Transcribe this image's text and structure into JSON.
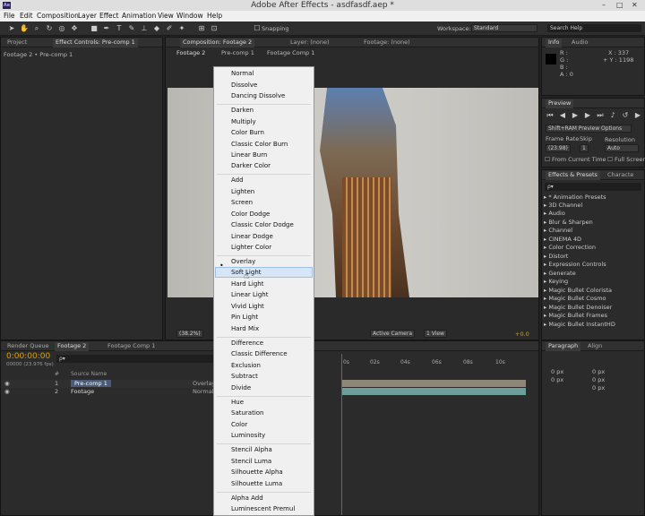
{
  "titlebar": {
    "title": "Adobe After Effects - asdfasdf.aep *",
    "app_badge": "Ae",
    "minimize": "–",
    "maximize": "□",
    "close": "✕"
  },
  "menu": [
    "File",
    "Edit",
    "Composition",
    "Layer",
    "Effect",
    "Animation",
    "View",
    "Window",
    "Help"
  ],
  "toolbar": {
    "snapping": "Snapping",
    "workspace_label": "Workspace:",
    "workspace_value": "Standard",
    "search_help": "Search Help"
  },
  "left_panel": {
    "tab_project": "Project",
    "tab_effect_controls": "Effect Controls: Pre-comp 1",
    "breadcrumb": "Footage 2 • Pre-comp 1"
  },
  "comp_panel": {
    "tab_composition": "Composition: Footage 2",
    "tab_layer": "Layer: (none)",
    "tab_footage": "Footage: (none)",
    "flow_tabs": [
      "Footage 2",
      "Pre-comp 1",
      "Footage Comp 1"
    ],
    "zoom": "(38.2%)",
    "camera": "Active Camera",
    "view": "1 View",
    "exposure": "+0.0"
  },
  "blend_menu": {
    "groups": [
      [
        "Normal",
        "Dissolve",
        "Dancing Dissolve"
      ],
      [
        "Darken",
        "Multiply",
        "Color Burn",
        "Classic Color Burn",
        "Linear Burn",
        "Darker Color"
      ],
      [
        "Add",
        "Lighten",
        "Screen",
        "Color Dodge",
        "Classic Color Dodge",
        "Linear Dodge",
        "Lighter Color"
      ],
      [
        "Overlay",
        "Soft Light",
        "Hard Light",
        "Linear Light",
        "Vivid Light",
        "Pin Light",
        "Hard Mix"
      ],
      [
        "Difference",
        "Classic Difference",
        "Exclusion",
        "Subtract",
        "Divide"
      ],
      [
        "Hue",
        "Saturation",
        "Color",
        "Luminosity"
      ],
      [
        "Stencil Alpha",
        "Stencil Luma",
        "Silhouette Alpha",
        "Silhouette Luma"
      ],
      [
        "Alpha Add",
        "Luminescent Premul"
      ]
    ],
    "checked": "Overlay",
    "hovered": "Soft Light"
  },
  "info_panel": {
    "tab_info": "Info",
    "tab_audio": "Audio",
    "r": "R :",
    "g": "G :",
    "b": "B :",
    "a": "A : 0",
    "x": "X : 337",
    "y": "+ Y : 1198"
  },
  "preview_panel": {
    "tab": "Preview",
    "mode": "Shift+RAM Preview Options",
    "frame_rate_label": "Frame Rate",
    "skip_label": "Skip",
    "resolution_label": "Resolution",
    "frame_rate": "(23.98)",
    "skip": "1",
    "resolution": "Auto",
    "from_current": "From Current Time",
    "full_screen": "Full Screen"
  },
  "effects_panel": {
    "tab_effects": "Effects & Presets",
    "tab_character": "Characte",
    "search_placeholder": "ρ▾",
    "items": [
      "* Animation Presets",
      "3D Channel",
      "Audio",
      "Blur & Sharpen",
      "Channel",
      "CINEMA 4D",
      "Color Correction",
      "Distort",
      "Expression Controls",
      "Generate",
      "Keying",
      "Magic Bullet Colorista",
      "Magic Bullet Cosmo",
      "Magic Bullet Denoiser",
      "Magic Bullet Frames",
      "Magic Bullet InstantHD"
    ]
  },
  "paragraph_panel": {
    "tab_paragraph": "Paragraph",
    "tab_align": "Align",
    "px1": "0 px",
    "px2": "0 px",
    "px3": "0 px",
    "px4": "0 px",
    "px5": "0 px"
  },
  "timeline": {
    "tab_render": "Render Queue",
    "tab_footage2": "Footage 2",
    "tab_footage_comp": "Footage Comp 1",
    "timecode": "0:00:00:00",
    "fps": "00000 (23.976 fps)",
    "search_placeholder": "ρ▾",
    "col_num": "#",
    "col_source": "Source Name",
    "ruler": [
      "0s",
      "02s",
      "04s",
      "06s",
      "08s",
      "10s"
    ],
    "layers": [
      {
        "num": "1",
        "name": "Pre-comp 1",
        "mode": "Overlay"
      },
      {
        "num": "2",
        "name": "Footage",
        "mode": "Normal"
      }
    ]
  }
}
